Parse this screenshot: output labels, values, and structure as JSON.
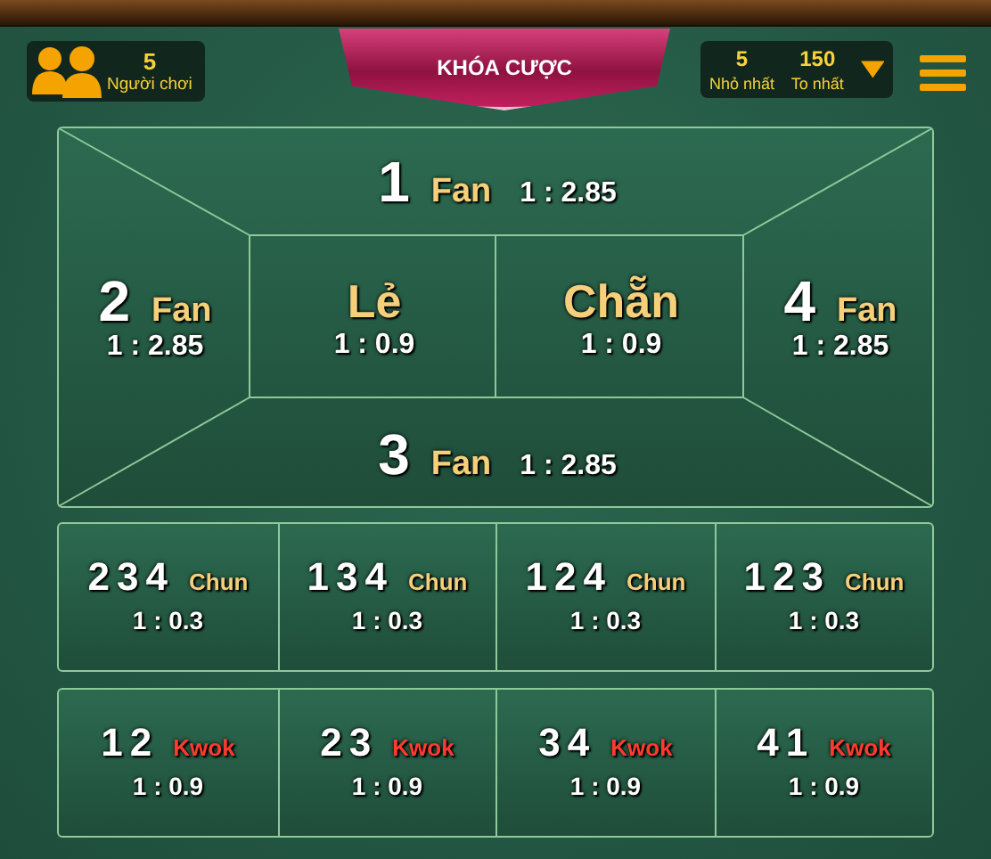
{
  "header": {
    "players": {
      "count": "5",
      "label": "Người chơi"
    },
    "lock_button": "KHÓA CƯỢC",
    "limits": [
      {
        "value": "5",
        "label": "Nhỏ nhất"
      },
      {
        "value": "150",
        "label": "To nhất"
      }
    ]
  },
  "board": {
    "fans": [
      {
        "kind": "top",
        "number": "1",
        "label": "Fan",
        "odds": "1 : 2.85"
      },
      {
        "kind": "left",
        "number": "2",
        "label": "Fan",
        "odds": "1 : 2.85"
      },
      {
        "kind": "right",
        "number": "4",
        "label": "Fan",
        "odds": "1 : 2.85"
      },
      {
        "kind": "bottom",
        "number": "3",
        "label": "Fan",
        "odds": "1 : 2.85"
      }
    ],
    "center": [
      {
        "label": "Lẻ",
        "odds": "1 : 0.9"
      },
      {
        "label": "Chẵn",
        "odds": "1 : 0.9"
      }
    ]
  },
  "rows": [
    {
      "kind": "chun",
      "bets": [
        {
          "number": "234",
          "label": "Chun",
          "odds": "1 : 0.3"
        },
        {
          "number": "134",
          "label": "Chun",
          "odds": "1 : 0.3"
        },
        {
          "number": "124",
          "label": "Chun",
          "odds": "1 : 0.3"
        },
        {
          "number": "123",
          "label": "Chun",
          "odds": "1 : 0.3"
        }
      ]
    },
    {
      "kind": "kwok",
      "bets": [
        {
          "number": "12",
          "label": "Kwok",
          "odds": "1 : 0.9"
        },
        {
          "number": "23",
          "label": "Kwok",
          "odds": "1 : 0.9"
        },
        {
          "number": "34",
          "label": "Kwok",
          "odds": "1 : 0.9"
        },
        {
          "number": "41",
          "label": "Kwok",
          "odds": "1 : 0.9"
        }
      ]
    }
  ]
}
